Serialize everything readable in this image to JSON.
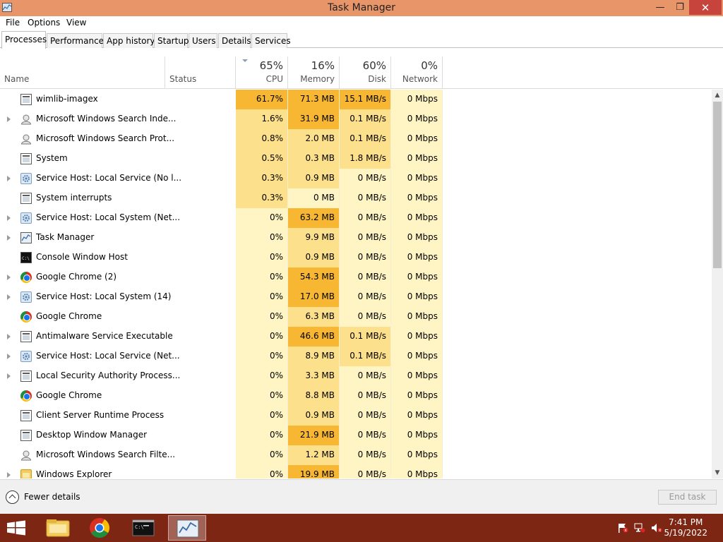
{
  "window": {
    "title": "Task Manager",
    "icon": "task-manager-icon",
    "controls": {
      "minimize": "—",
      "maximize": "❐",
      "close": "✕"
    }
  },
  "menu": [
    "File",
    "Options",
    "View"
  ],
  "tabs": [
    "Processes",
    "Performance",
    "App history",
    "Startup",
    "Users",
    "Details",
    "Services"
  ],
  "active_tab": "Processes",
  "columns": {
    "name": "Name",
    "status": "Status",
    "cpu": {
      "percent": "65%",
      "label": "CPU"
    },
    "memory": {
      "percent": "16%",
      "label": "Memory"
    },
    "disk": {
      "percent": "60%",
      "label": "Disk"
    },
    "network": {
      "percent": "0%",
      "label": "Network"
    }
  },
  "processes": [
    {
      "name": "wimlib-imagex",
      "expandable": false,
      "icon": "app-icon",
      "cpu": "61.7%",
      "memory": "71.3 MB",
      "disk": "15.1 MB/s",
      "network": "0 Mbps"
    },
    {
      "name": "Microsoft Windows Search Inde...",
      "expandable": true,
      "icon": "user-icon",
      "cpu": "1.6%",
      "memory": "31.9 MB",
      "disk": "0.1 MB/s",
      "network": "0 Mbps"
    },
    {
      "name": "Microsoft Windows Search Prot...",
      "expandable": false,
      "icon": "user-icon",
      "cpu": "0.8%",
      "memory": "2.0 MB",
      "disk": "0.1 MB/s",
      "network": "0 Mbps"
    },
    {
      "name": "System",
      "expandable": false,
      "icon": "app-icon",
      "cpu": "0.5%",
      "memory": "0.3 MB",
      "disk": "1.8 MB/s",
      "network": "0 Mbps"
    },
    {
      "name": "Service Host: Local Service (No l...",
      "expandable": true,
      "icon": "gear-icon",
      "cpu": "0.3%",
      "memory": "0.9 MB",
      "disk": "0 MB/s",
      "network": "0 Mbps"
    },
    {
      "name": "System interrupts",
      "expandable": false,
      "icon": "app-icon",
      "cpu": "0.3%",
      "memory": "0 MB",
      "disk": "0 MB/s",
      "network": "0 Mbps"
    },
    {
      "name": "Service Host: Local System (Net...",
      "expandable": true,
      "icon": "gear-icon",
      "cpu": "0%",
      "memory": "63.2 MB",
      "disk": "0 MB/s",
      "network": "0 Mbps"
    },
    {
      "name": "Task Manager",
      "expandable": true,
      "icon": "task-manager-icon",
      "cpu": "0%",
      "memory": "9.9 MB",
      "disk": "0 MB/s",
      "network": "0 Mbps"
    },
    {
      "name": "Console Window Host",
      "expandable": false,
      "icon": "console-icon",
      "cpu": "0%",
      "memory": "0.9 MB",
      "disk": "0 MB/s",
      "network": "0 Mbps"
    },
    {
      "name": "Google Chrome (2)",
      "expandable": true,
      "icon": "chrome-icon",
      "cpu": "0%",
      "memory": "54.3 MB",
      "disk": "0 MB/s",
      "network": "0 Mbps"
    },
    {
      "name": "Service Host: Local System (14)",
      "expandable": true,
      "icon": "gear-icon",
      "cpu": "0%",
      "memory": "17.0 MB",
      "disk": "0 MB/s",
      "network": "0 Mbps"
    },
    {
      "name": "Google Chrome",
      "expandable": false,
      "icon": "chrome-icon",
      "cpu": "0%",
      "memory": "6.3 MB",
      "disk": "0 MB/s",
      "network": "0 Mbps"
    },
    {
      "name": "Antimalware Service Executable",
      "expandable": true,
      "icon": "app-icon",
      "cpu": "0%",
      "memory": "46.6 MB",
      "disk": "0.1 MB/s",
      "network": "0 Mbps"
    },
    {
      "name": "Service Host: Local Service (Net...",
      "expandable": true,
      "icon": "gear-icon",
      "cpu": "0%",
      "memory": "8.9 MB",
      "disk": "0.1 MB/s",
      "network": "0 Mbps"
    },
    {
      "name": "Local Security Authority Process...",
      "expandable": true,
      "icon": "app-icon",
      "cpu": "0%",
      "memory": "3.3 MB",
      "disk": "0 MB/s",
      "network": "0 Mbps"
    },
    {
      "name": "Google Chrome",
      "expandable": false,
      "icon": "chrome-icon",
      "cpu": "0%",
      "memory": "8.8 MB",
      "disk": "0 MB/s",
      "network": "0 Mbps"
    },
    {
      "name": "Client Server Runtime Process",
      "expandable": false,
      "icon": "app-icon",
      "cpu": "0%",
      "memory": "0.9 MB",
      "disk": "0 MB/s",
      "network": "0 Mbps"
    },
    {
      "name": "Desktop Window Manager",
      "expandable": false,
      "icon": "app-icon",
      "cpu": "0%",
      "memory": "21.9 MB",
      "disk": "0 MB/s",
      "network": "0 Mbps"
    },
    {
      "name": "Microsoft Windows Search Filte...",
      "expandable": false,
      "icon": "user-icon",
      "cpu": "0%",
      "memory": "1.2 MB",
      "disk": "0 MB/s",
      "network": "0 Mbps"
    },
    {
      "name": "Windows Explorer",
      "expandable": true,
      "icon": "folder-icon",
      "cpu": "0%",
      "memory": "19.9 MB",
      "disk": "0 MB/s",
      "network": "0 Mbps"
    }
  ],
  "footer": {
    "fewer_details": "Fewer details",
    "end_task": "End task"
  },
  "taskbar": {
    "items": [
      "file-explorer-icon",
      "chrome-icon",
      "console-icon",
      "task-manager-icon"
    ],
    "active_item": "task-manager-icon",
    "tray_icons": [
      "action-center-flag-icon",
      "network-icon",
      "volume-muted-icon"
    ],
    "time": "7:41 PM",
    "date": "5/19/2022"
  },
  "colors": {
    "titlebar": "#e8956a",
    "close": "#c7443c",
    "taskbar": "#7e2614",
    "heat_high": "#f8b732",
    "heat_mid": "#fde08b",
    "heat_low": "#fff4c4"
  }
}
